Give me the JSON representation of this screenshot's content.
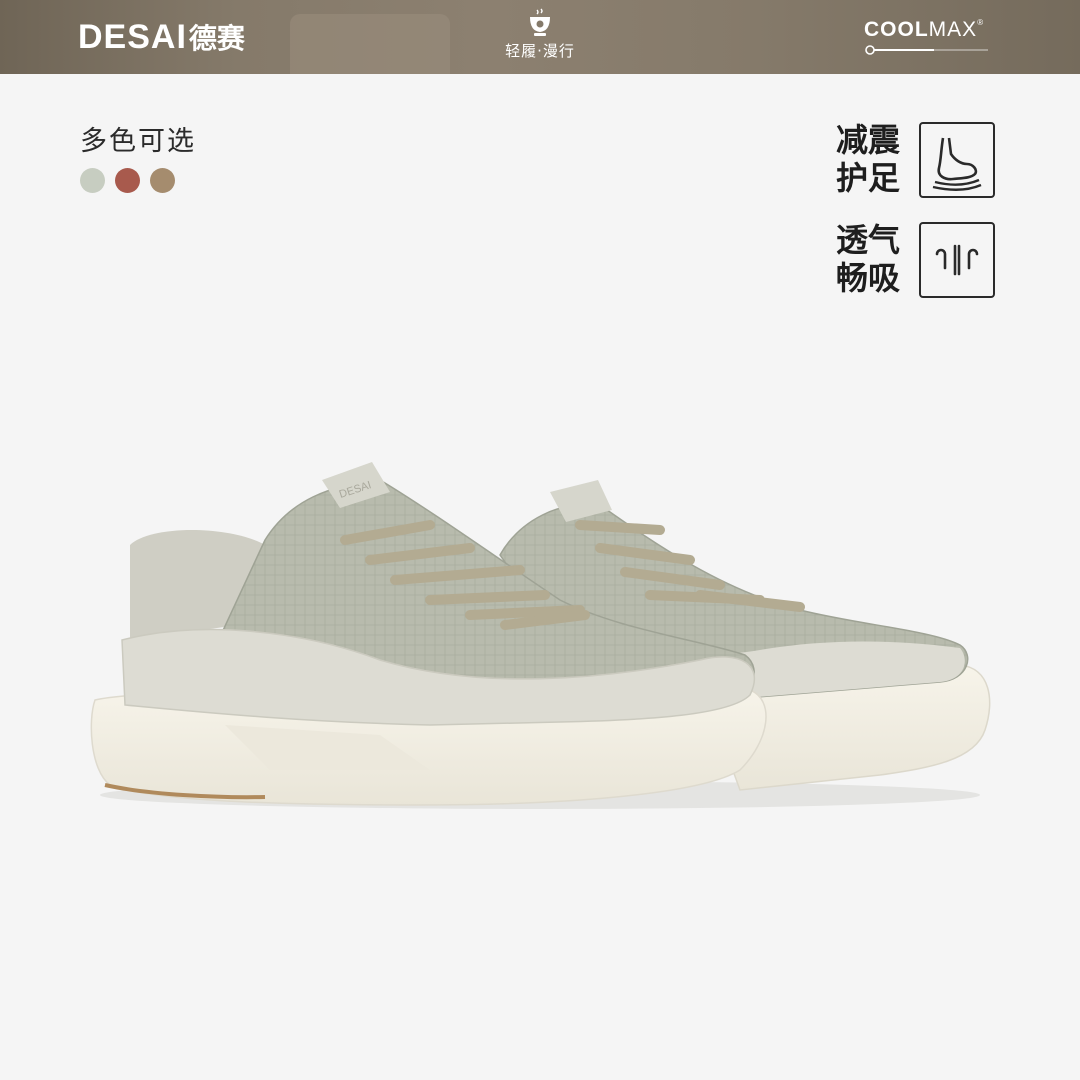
{
  "header": {
    "brand_en": "DESAI",
    "brand_cn": "德赛",
    "center_logo_icon": "cup-icon",
    "tagline": "轻履·漫行",
    "partner_bold": "COOL",
    "partner_light": "MAX",
    "partner_tm": "®"
  },
  "colors": {
    "title": "多色可选",
    "swatches": [
      "#c7cdc1",
      "#a85a4d",
      "#a58c6e"
    ]
  },
  "features": [
    {
      "line1": "减震",
      "line2": "护足",
      "icon": "foot-cushion-icon"
    },
    {
      "line1": "透气",
      "line2": "畅吸",
      "icon": "breathable-airflow-icon"
    }
  ],
  "product": {
    "name": "sneaker-pair",
    "tongue_label": "DESAI"
  },
  "theme": {
    "header_bg": "#857a6a",
    "background": "#f5f5f5",
    "upper_color": "#b9bcae",
    "sole_color": "#f3f0e6"
  }
}
